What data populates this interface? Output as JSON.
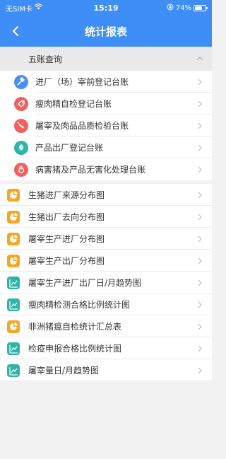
{
  "status_bar": {
    "carrier": "无SIM卡",
    "time": "15:19",
    "battery": "74%",
    "battery_level": 0.74
  },
  "nav": {
    "title": "统计报表"
  },
  "group": {
    "title": "五账查询",
    "items": [
      {
        "label": "进厂（场）宰前登记台账",
        "icon": "tools-icon",
        "color": "#4a8ff5"
      },
      {
        "label": "瘦肉精自检登记台账",
        "icon": "tag-icon",
        "color": "#f0625f"
      },
      {
        "label": "屠宰及肉品品质检验台账",
        "icon": "knife-icon",
        "color": "#f0625f"
      },
      {
        "label": "产品出厂登记台账",
        "icon": "leaf-icon",
        "color": "#2fb5a6"
      },
      {
        "label": "病害猪及产品无害化处理台账",
        "icon": "flame-icon",
        "color": "#f0625f"
      }
    ]
  },
  "reports": [
    {
      "label": "生猪进厂来源分布图",
      "icon": "pie-chart-icon",
      "color": "#f5a623"
    },
    {
      "label": "生猪出厂去向分布图",
      "icon": "pie-chart-icon",
      "color": "#f5a623"
    },
    {
      "label": "屠宰生产进厂分布图",
      "icon": "pie-chart-icon",
      "color": "#f5a623"
    },
    {
      "label": "屠宰生产出厂分布图",
      "icon": "pie-chart-icon",
      "color": "#f5a623"
    },
    {
      "label": "屠宰生产进厂出厂日/月趋势图",
      "icon": "line-chart-icon",
      "color": "#2fb5a6"
    },
    {
      "label": "瘦肉精检测合格比例统计图",
      "icon": "line-chart-icon",
      "color": "#2fb5a6"
    },
    {
      "label": "非洲猪瘟自检统计汇总表",
      "icon": "pie-chart-icon",
      "color": "#f5a623"
    },
    {
      "label": "检疫申报合格比例统计图",
      "icon": "line-chart-icon",
      "color": "#2fb5a6"
    },
    {
      "label": "屠宰量日/月趋势图",
      "icon": "line-chart-icon",
      "color": "#2fb5a6"
    }
  ]
}
